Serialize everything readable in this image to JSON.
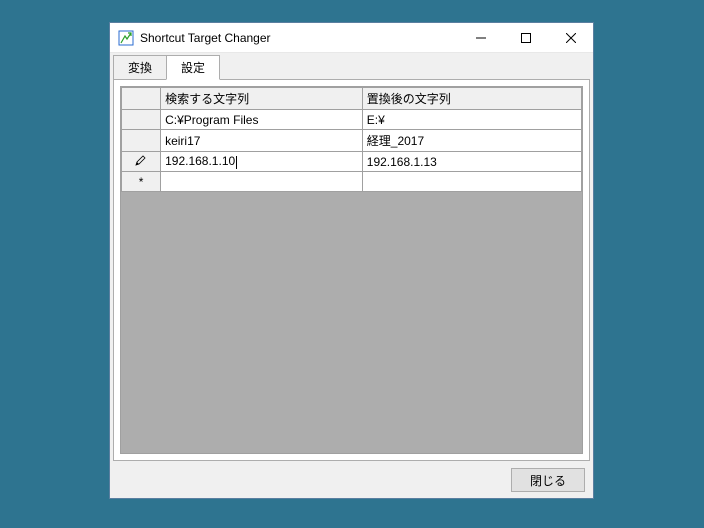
{
  "window": {
    "title": "Shortcut Target Changer"
  },
  "tabs": {
    "convert": "変換",
    "settings": "設定"
  },
  "grid": {
    "headers": {
      "search": "検索する文字列",
      "replace": "置換後の文字列"
    },
    "rows": [
      {
        "search": "C:¥Program Files",
        "replace": "E:¥"
      },
      {
        "search": "keiri17",
        "replace": "経理_2017"
      },
      {
        "search": "192.168.1.10",
        "replace": "192.168.1.13"
      }
    ],
    "newRowMarker": "*"
  },
  "footer": {
    "close": "閉じる"
  }
}
